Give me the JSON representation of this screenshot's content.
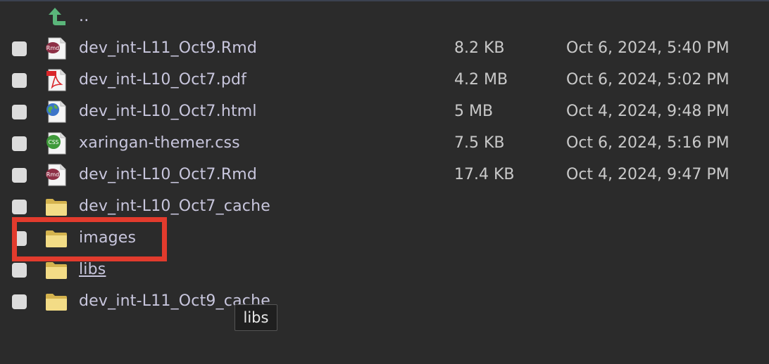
{
  "parent_dir": {
    "label": ".."
  },
  "files": [
    {
      "name": "dev_int-L11_Oct9.Rmd",
      "size": "8.2 KB",
      "modified": "Oct 6, 2024, 5:40 PM",
      "icon": "rmd-file-icon"
    },
    {
      "name": "dev_int-L10_Oct7.pdf",
      "size": "4.2 MB",
      "modified": "Oct 6, 2024, 5:02 PM",
      "icon": "pdf-file-icon"
    },
    {
      "name": "dev_int-L10_Oct7.html",
      "size": "5 MB",
      "modified": "Oct 4, 2024, 9:48 PM",
      "icon": "html-file-icon"
    },
    {
      "name": "xaringan-themer.css",
      "size": "7.5 KB",
      "modified": "Oct 6, 2024, 5:16 PM",
      "icon": "css-file-icon"
    },
    {
      "name": "dev_int-L10_Oct7.Rmd",
      "size": "17.4 KB",
      "modified": "Oct 4, 2024, 9:47 PM",
      "icon": "rmd-file-icon"
    },
    {
      "name": "dev_int-L10_Oct7_cache",
      "size": "",
      "modified": "",
      "icon": "folder-icon"
    },
    {
      "name": "images",
      "size": "",
      "modified": "",
      "icon": "folder-icon"
    },
    {
      "name": "libs",
      "size": "",
      "modified": "",
      "icon": "folder-icon"
    },
    {
      "name": "dev_int-L11_Oct9_cache",
      "size": "",
      "modified": "",
      "icon": "folder-icon"
    }
  ],
  "icon_badges": {
    "rmd": "Rmd",
    "css": "CSS"
  },
  "tooltip": {
    "text": "libs"
  },
  "colors": {
    "highlight": "#e23b2d",
    "background": "#2b2b2b",
    "filename": "#c8c6dd"
  }
}
